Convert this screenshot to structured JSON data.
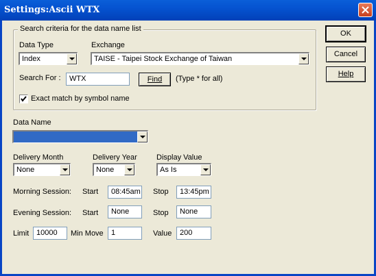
{
  "window": {
    "title": "Settings:Ascii WTX"
  },
  "search": {
    "group_label": "Search criteria for the data name list",
    "data_type_label": "Data Type",
    "data_type_value": "Index",
    "exchange_label": "Exchange",
    "exchange_value": "TAISE - Taipei Stock Exchange of Taiwan",
    "search_for_label": "Search For :",
    "search_for_value": "WTX",
    "find_button": "Find",
    "find_hint": "(Type * for all)",
    "exact_match_label": "Exact match by symbol name",
    "exact_match_checked": true
  },
  "data_name": {
    "label": "Data Name",
    "value": ""
  },
  "delivery": {
    "month_label": "Delivery Month",
    "month_value": "None",
    "year_label": "Delivery Year",
    "year_value": "None",
    "display_label": "Display Value",
    "display_value": "As Is"
  },
  "sessions": {
    "morning_label": "Morning Session:",
    "evening_label": "Evening Session:",
    "start_label": "Start",
    "stop_label": "Stop",
    "morning_start": "08:45am",
    "morning_stop": "13:45pm",
    "evening_start": "None",
    "evening_stop": "None"
  },
  "limits": {
    "limit_label": "Limit",
    "limit_value": "10000",
    "min_move_label": "Min Move",
    "min_move_value": "1",
    "value_label": "Value",
    "value_value": "200"
  },
  "buttons": {
    "ok": "OK",
    "cancel": "Cancel",
    "help": "Help"
  },
  "colors": {
    "title_bar": "#0553D0",
    "dialog_bg": "#ECE9D8",
    "selection": "#316AC5"
  }
}
